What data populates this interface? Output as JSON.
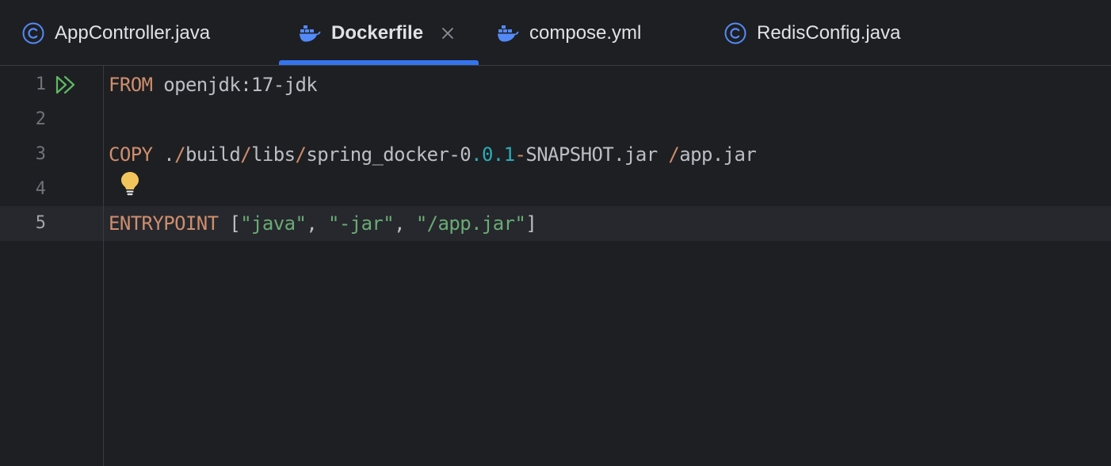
{
  "tabs": [
    {
      "label": "AppController.java",
      "icon": "java-class-icon",
      "active": false
    },
    {
      "label": "Dockerfile",
      "icon": "docker-icon",
      "active": true
    },
    {
      "label": "compose.yml",
      "icon": "docker-icon",
      "active": false
    },
    {
      "label": "RedisConfig.java",
      "icon": "java-class-icon",
      "active": false
    }
  ],
  "colors": {
    "background": "#1e1f22",
    "current_line": "#26282e",
    "keyword": "#cf8e6d",
    "string": "#6aab73",
    "number": "#2aacb8",
    "accent": "#3574f0",
    "run_icon": "#5fb865",
    "bulb": "#f2c55c",
    "class_icon": "#548af7"
  },
  "editor": {
    "current_line": 5,
    "lines": [
      {
        "number": "1",
        "tokens": [
          {
            "type": "kw",
            "text": "FROM"
          },
          {
            "type": "plain",
            "text": " openjdk:17-jdk"
          }
        ]
      },
      {
        "number": "2",
        "tokens": []
      },
      {
        "number": "3",
        "tokens": [
          {
            "type": "kw",
            "text": "COPY"
          },
          {
            "type": "plain",
            "text": " ."
          },
          {
            "type": "path",
            "text": "/"
          },
          {
            "type": "plain",
            "text": "build"
          },
          {
            "type": "path",
            "text": "/"
          },
          {
            "type": "plain",
            "text": "libs"
          },
          {
            "type": "path",
            "text": "/"
          },
          {
            "type": "plain",
            "text": "spring_docker-0"
          },
          {
            "type": "num",
            "text": ".0.1"
          },
          {
            "type": "path",
            "text": "-"
          },
          {
            "type": "plain",
            "text": "SNAPSHOT.jar "
          },
          {
            "type": "path",
            "text": "/"
          },
          {
            "type": "plain",
            "text": "app.jar"
          }
        ]
      },
      {
        "number": "4",
        "tokens": []
      },
      {
        "number": "5",
        "tokens": [
          {
            "type": "kw",
            "text": "ENTRYPOINT"
          },
          {
            "type": "plain",
            "text": " ["
          },
          {
            "type": "str",
            "text": "\"java\""
          },
          {
            "type": "plain",
            "text": ", "
          },
          {
            "type": "str",
            "text": "\"-jar\""
          },
          {
            "type": "plain",
            "text": ", "
          },
          {
            "type": "str",
            "text": "\"/app.jar\""
          },
          {
            "type": "plain",
            "text": "]"
          }
        ]
      }
    ]
  },
  "gutter": {
    "run_icon": "run-all-icon",
    "intention_icon": "lightbulb-icon"
  }
}
